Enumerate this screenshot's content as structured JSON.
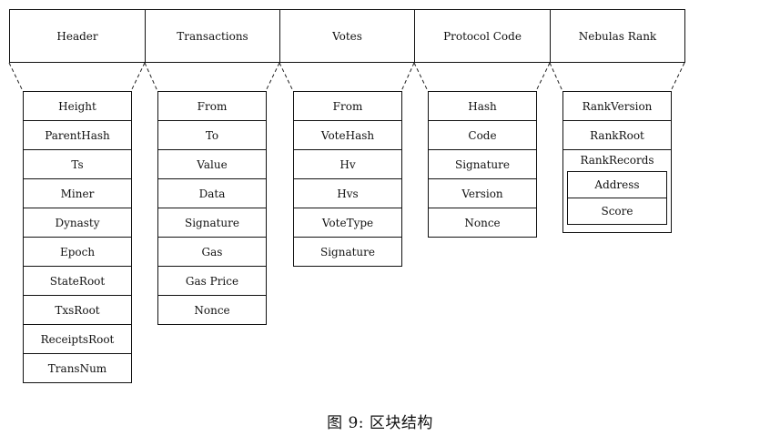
{
  "top_row": [
    {
      "label": "Header"
    },
    {
      "label": "Transactions"
    },
    {
      "label": "Votes"
    },
    {
      "label": "Protocol Code"
    },
    {
      "label": "Nebulas Rank"
    }
  ],
  "columns": [
    {
      "items": [
        "Height",
        "ParentHash",
        "Ts",
        "Miner",
        "Dynasty",
        "Epoch",
        "StateRoot",
        "TxsRoot",
        "ReceiptsRoot",
        "TransNum"
      ]
    },
    {
      "items": [
        "From",
        "To",
        "Value",
        "Data",
        "Signature",
        "Gas",
        "Gas Price",
        "Nonce"
      ]
    },
    {
      "items": [
        "From",
        "VoteHash",
        "Hv",
        "Hvs",
        "VoteType",
        "Signature"
      ]
    },
    {
      "items": [
        "Hash",
        "Code",
        "Signature",
        "Version",
        "Nonce"
      ]
    },
    {
      "items": [
        "RankVersion",
        "RankRoot"
      ],
      "nested": {
        "label": "RankRecords",
        "items": [
          "Address",
          "Score"
        ]
      }
    }
  ],
  "caption": "图 9: 区块结构"
}
